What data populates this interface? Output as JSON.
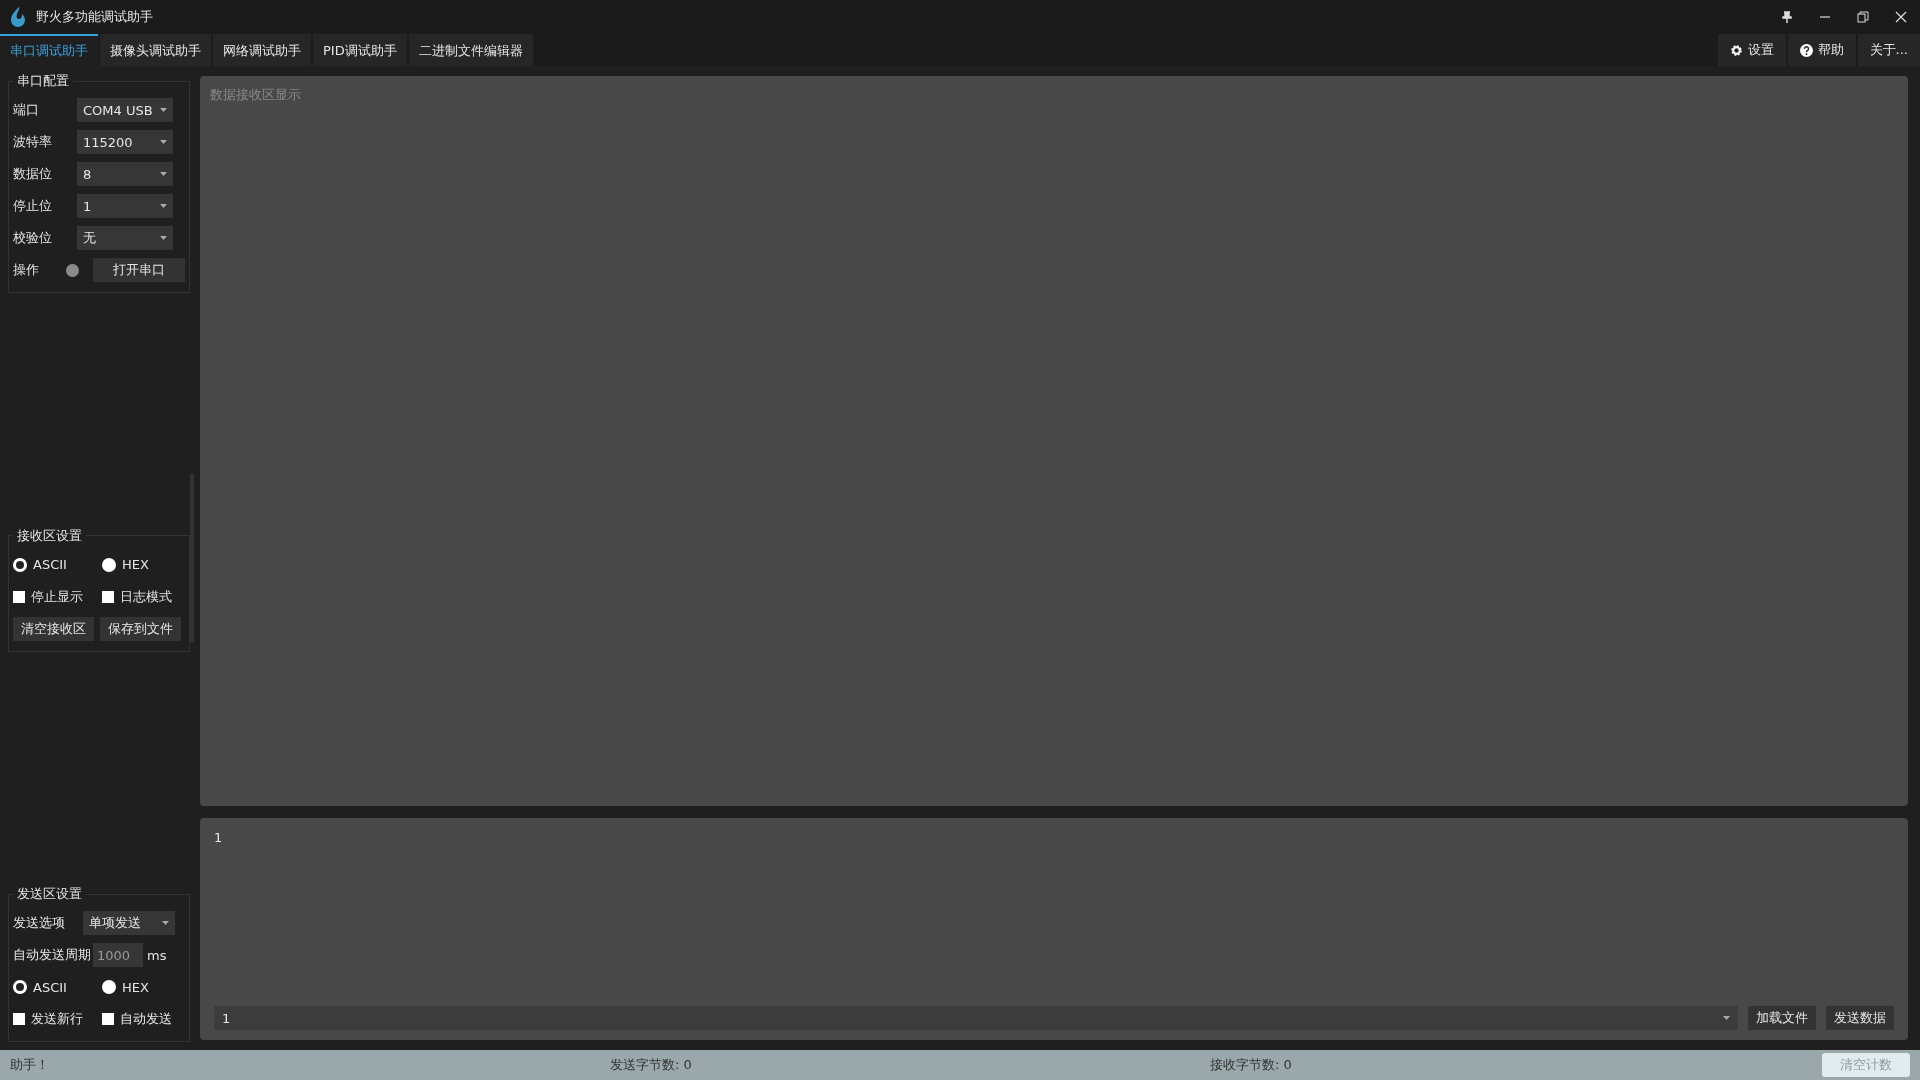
{
  "window": {
    "title": "野火多功能调试助手"
  },
  "tabs": [
    {
      "label": "串口调试助手",
      "selected": true
    },
    {
      "label": "摄像头调试助手",
      "selected": false
    },
    {
      "label": "网络调试助手",
      "selected": false
    },
    {
      "label": "PID调试助手",
      "selected": false
    },
    {
      "label": "二进制文件编辑器",
      "selected": false
    }
  ],
  "toolbar": [
    {
      "kind": "settings",
      "label": "设置"
    },
    {
      "kind": "help",
      "label": "帮助"
    },
    {
      "kind": "about",
      "label": "关于..."
    }
  ],
  "serial_config": {
    "title": "串口配置",
    "fields": [
      {
        "label": "端口",
        "value": "COM4 USB"
      },
      {
        "label": "波特率",
        "value": "115200"
      },
      {
        "label": "数据位",
        "value": "8"
      },
      {
        "label": "停止位",
        "value": "1"
      },
      {
        "label": "校验位",
        "value": "无"
      }
    ],
    "operation": {
      "label": "操作",
      "on": false,
      "button": "打开串口"
    }
  },
  "receive_settings": {
    "title": "接收区设置",
    "modes": [
      {
        "label": "ASCII",
        "selected": true
      },
      {
        "label": "HEX",
        "selected": false
      }
    ],
    "options": [
      {
        "label": "停止显示",
        "checked": false
      },
      {
        "label": "日志模式",
        "checked": false
      }
    ],
    "buttons": [
      "清空接收区",
      "保存到文件"
    ]
  },
  "send_settings": {
    "title": "发送区设置",
    "send_option": {
      "label": "发送选项",
      "value": "单项发送"
    },
    "period": {
      "label": "自动发送周期",
      "value": "1000",
      "unit": "ms"
    },
    "modes": [
      {
        "label": "ASCII",
        "selected": true
      },
      {
        "label": "HEX",
        "selected": false
      }
    ],
    "options": [
      {
        "label": "发送新行",
        "checked": false
      },
      {
        "label": "自动发送",
        "checked": false
      }
    ]
  },
  "receive_area": {
    "placeholder": "数据接收区显示"
  },
  "send_area": {
    "value": "1",
    "history_value": "1",
    "buttons": [
      "加载文件",
      "发送数据"
    ]
  },
  "status_bar": {
    "message": "助手！",
    "sent": "发送字节数: 0",
    "received": "接收字节数: 0",
    "button": "清空计数"
  }
}
